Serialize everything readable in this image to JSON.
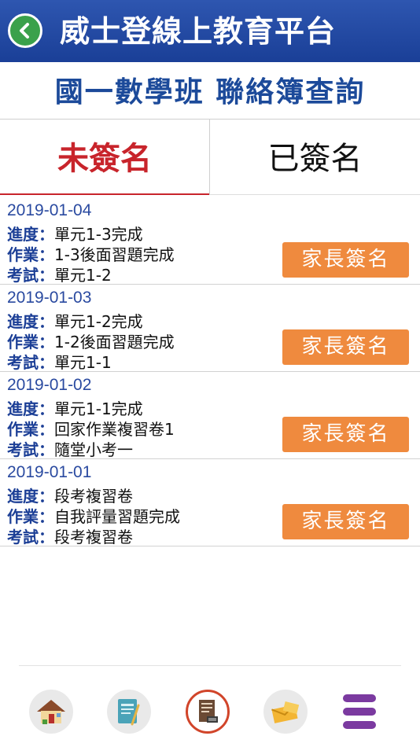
{
  "header": {
    "title": "威士登線上教育平台"
  },
  "subtitle": "國一數學班  聯絡簿查詢",
  "tabs": [
    {
      "label": "未簽名",
      "active": true
    },
    {
      "label": "已簽名",
      "active": false
    }
  ],
  "labels": {
    "progress": "進度：",
    "homework": "作業：",
    "exam": "考試："
  },
  "entries": [
    {
      "date": "2019-01-04",
      "progress": "單元1-3完成",
      "homework": "1-3後面習題完成",
      "exam": "單元1-2",
      "button": "家長簽名"
    },
    {
      "date": "2019-01-03",
      "progress": "單元1-2完成",
      "homework": "1-2後面習題完成",
      "exam": "單元1-1",
      "button": "家長簽名"
    },
    {
      "date": "2019-01-02",
      "progress": "單元1-1完成",
      "homework": "回家作業複習卷1",
      "exam": "隨堂小考一",
      "button": "家長簽名"
    },
    {
      "date": "2019-01-01",
      "progress": "段考複習卷",
      "homework": "自我評量習題完成",
      "exam": "段考複習卷",
      "button": "家長簽名"
    }
  ],
  "bottom_nav": [
    {
      "icon": "home-icon",
      "active": false
    },
    {
      "icon": "notebook-icon",
      "active": false
    },
    {
      "icon": "contact-book-stamp-icon",
      "active": true
    },
    {
      "icon": "mail-icon",
      "active": false
    },
    {
      "icon": "menu-icon",
      "active": false
    }
  ],
  "colors": {
    "header": "#1f4aa6",
    "title_blue": "#1c4a9a",
    "active_tab": "#c8242b",
    "button": "#ef8a3e",
    "back_button": "#3aa14b"
  }
}
